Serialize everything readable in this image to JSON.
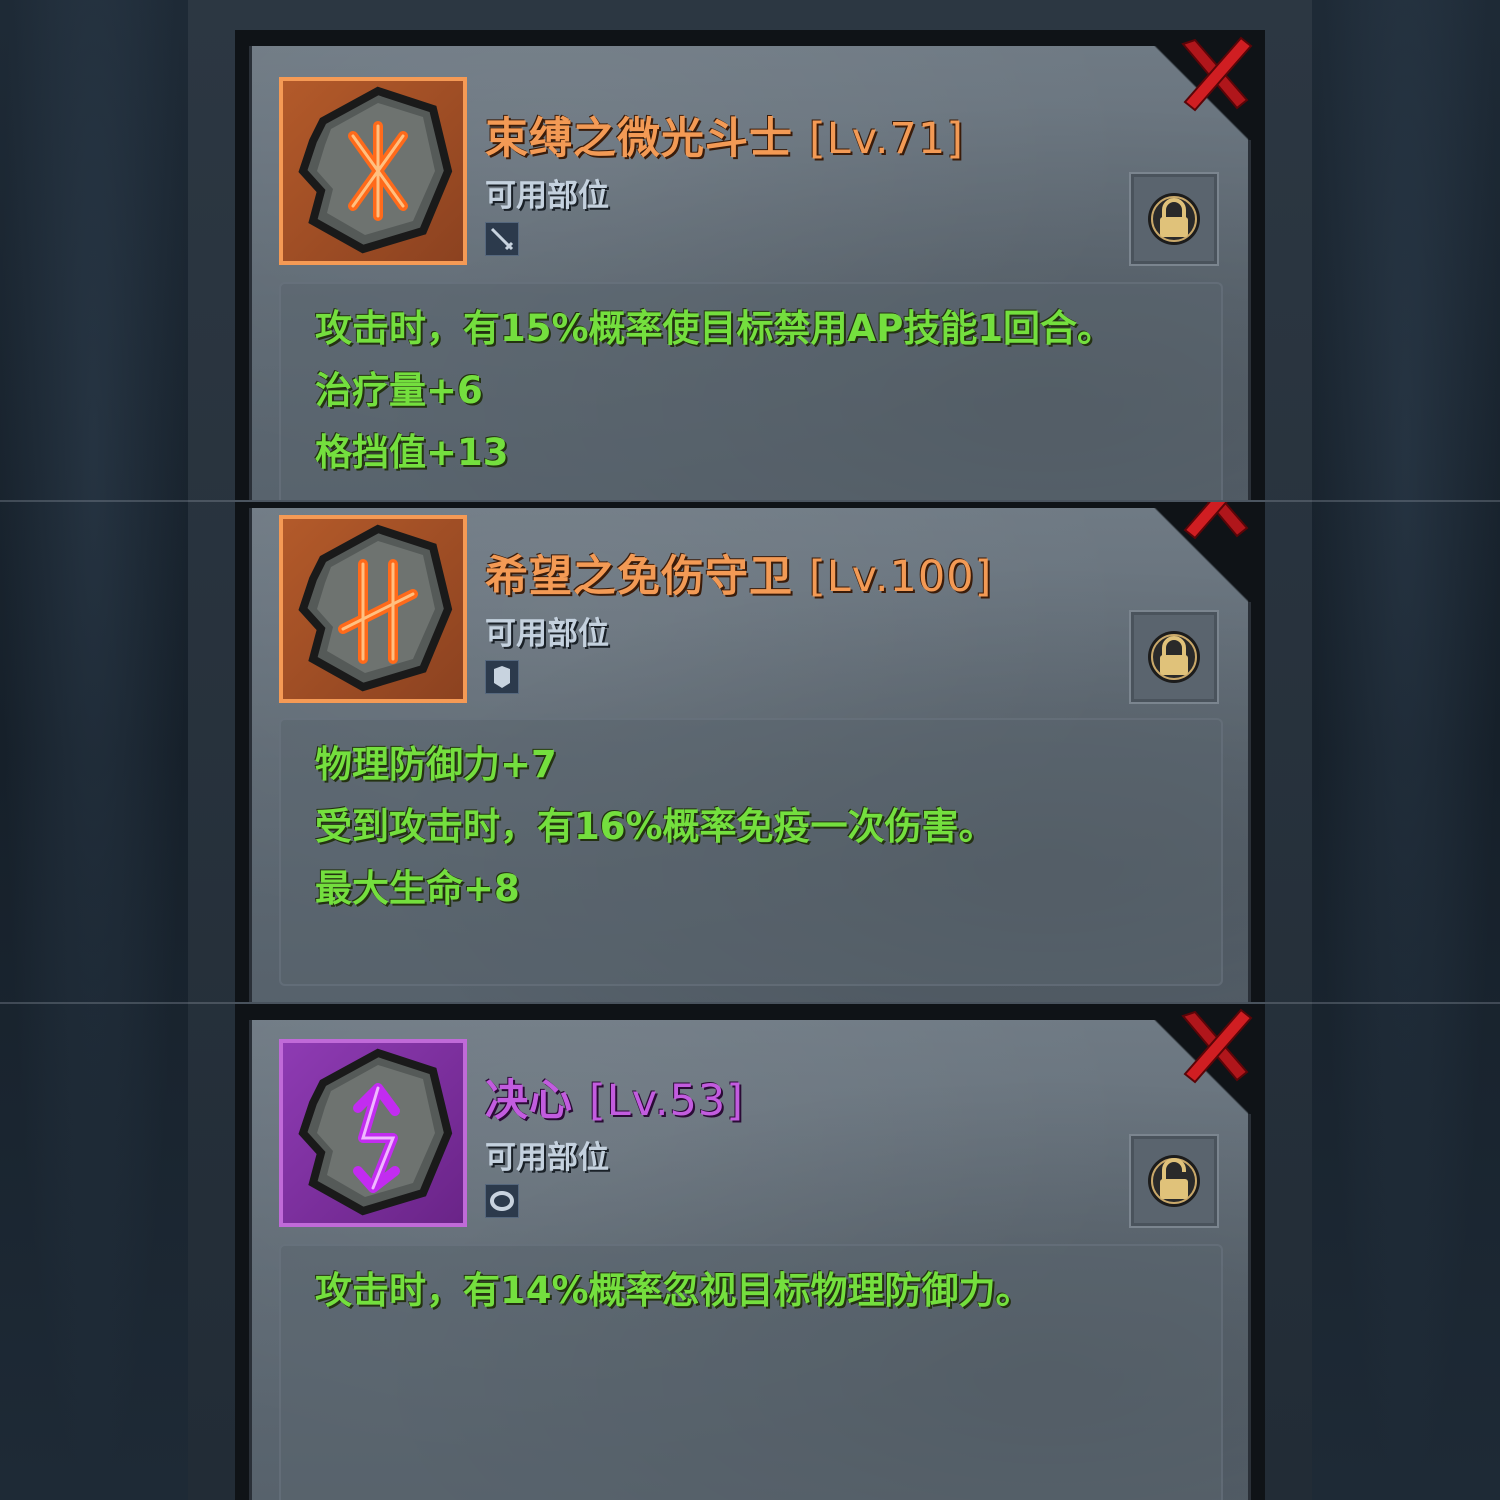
{
  "runes": [
    {
      "name": "束缚之微光斗士",
      "level": "[Lv.71]",
      "slot_label": "可用部位",
      "slot_icon": "sword-icon",
      "rarity_color": "#f39a55",
      "locked": true,
      "effects": [
        "攻击时，有15%概率使目标禁用AP技能1回合。",
        "治疗量+6",
        "格挡值+13"
      ]
    },
    {
      "name": "希望之免伤守卫",
      "level": "[Lv.100]",
      "slot_label": "可用部位",
      "slot_icon": "armor-icon",
      "rarity_color": "#f39a55",
      "locked": true,
      "effects": [
        "物理防御力+7",
        "受到攻击时，有16%概率免疫一次伤害。",
        "最大生命+8"
      ]
    },
    {
      "name": "决心",
      "level": "[Lv.53]",
      "slot_label": "可用部位",
      "slot_icon": "ring-icon",
      "rarity_color": "#c25cdf",
      "locked": false,
      "effects": [
        "攻击时，有14%概率忽视目标物理防御力。"
      ]
    }
  ]
}
